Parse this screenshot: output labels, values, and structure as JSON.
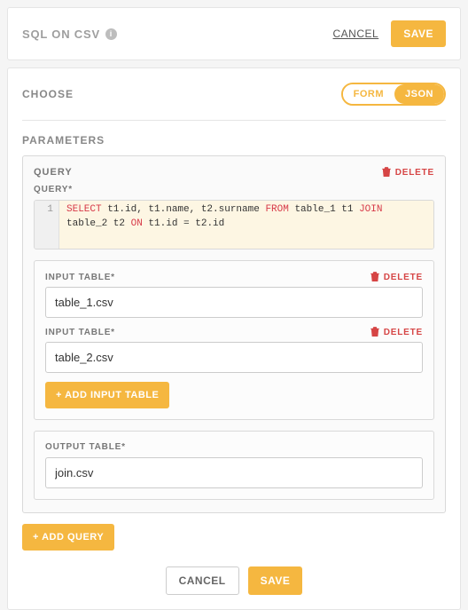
{
  "header": {
    "title": "SQL ON CSV",
    "cancel": "CANCEL",
    "save": "SAVE"
  },
  "choose": {
    "label": "CHOOSE",
    "form": "FORM",
    "json": "JSON"
  },
  "parameters": {
    "label": "PARAMETERS"
  },
  "query_panel": {
    "title": "QUERY",
    "delete": "DELETE",
    "query_label": "QUERY*",
    "line_number": "1",
    "sql_tokens": {
      "select": "SELECT",
      "cols": " t1.id, t1.name, t2.surname ",
      "from": "FROM",
      "from_tbl": " table_1 t1 ",
      "join": "JOIN",
      "join_tbl": " table_2 t2 ",
      "on": "ON",
      "on_expr": " t1.id = t2.id"
    }
  },
  "input_tables": {
    "label": "INPUT TABLE*",
    "delete": "DELETE",
    "items": [
      {
        "value": "table_1.csv"
      },
      {
        "value": "table_2.csv"
      }
    ],
    "add": "+ ADD INPUT TABLE"
  },
  "output_table": {
    "label": "OUTPUT TABLE*",
    "value": "join.csv"
  },
  "add_query": "+ ADD QUERY",
  "footer": {
    "cancel": "CANCEL",
    "save": "SAVE"
  }
}
